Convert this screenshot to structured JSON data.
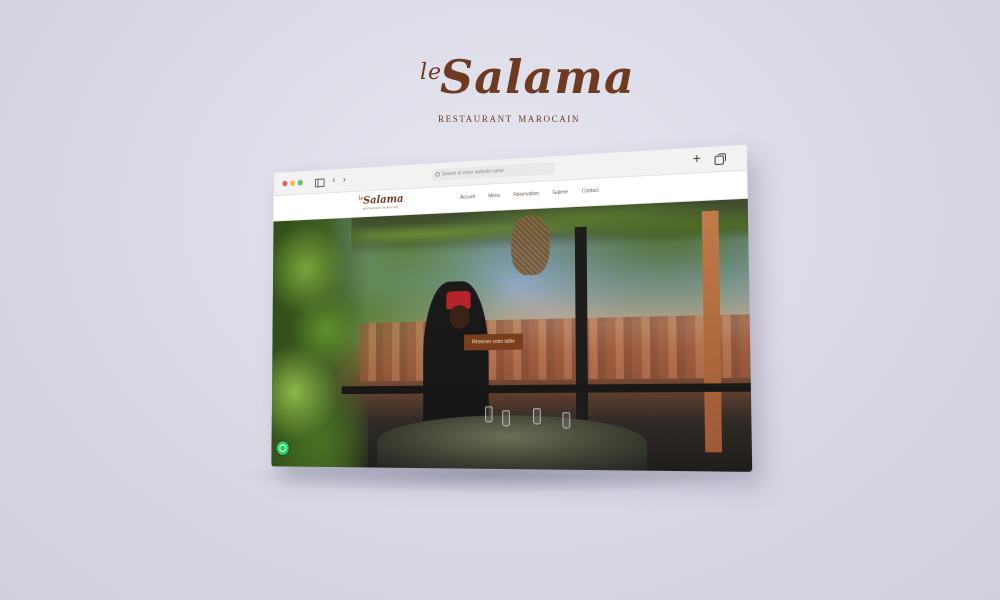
{
  "brand": {
    "prefix": "le",
    "name": "Salama",
    "sub_left": "RESTAURANT",
    "sub_right": "MAROCAIN"
  },
  "browser": {
    "address_placeholder": "Search or enter website name",
    "icons": [
      "sidebar-icon",
      "back-icon",
      "forward-icon",
      "search-icon",
      "plus-icon",
      "tabs-icon"
    ]
  },
  "site": {
    "logo_prefix": "le",
    "logo_name": "Salama",
    "logo_sub": "RESTAURANT MAROCAIN",
    "nav": [
      "Accueil",
      "Menu",
      "Réservation",
      "Galerie",
      "Contact"
    ],
    "cta_label": "Réserver votre table"
  },
  "colors": {
    "brand_brown": "#6e3a22",
    "cta_bg": "#7a3e1d",
    "whatsapp": "#25d366"
  }
}
